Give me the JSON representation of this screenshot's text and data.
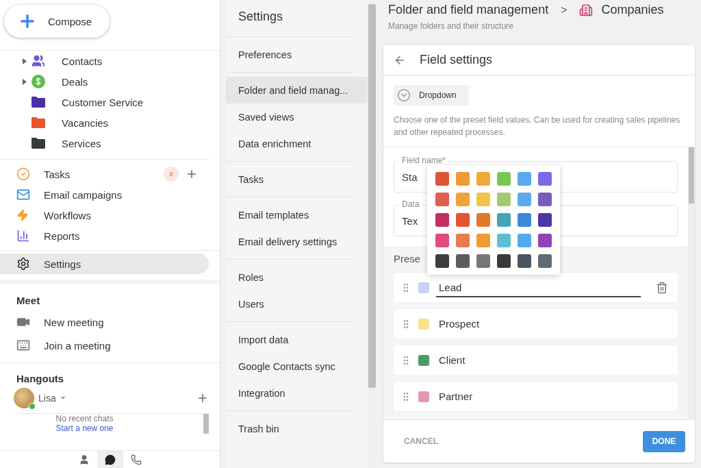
{
  "compose": {
    "label": "Compose"
  },
  "folders": [
    {
      "label": "Contacts",
      "kind": "contacts",
      "expandable": true,
      "color": "#6a5ad6"
    },
    {
      "label": "Deals",
      "kind": "deals",
      "expandable": true,
      "color": "#5cbf4a"
    },
    {
      "label": "Customer Service",
      "kind": "folder",
      "expandable": false,
      "color": "#4b2ea8"
    },
    {
      "label": "Vacancies",
      "kind": "folder",
      "expandable": false,
      "color": "#e8552d"
    },
    {
      "label": "Services",
      "kind": "folder",
      "expandable": false,
      "color": "#3a3a3a"
    }
  ],
  "apps": [
    {
      "label": "Tasks",
      "kind": "tasks",
      "badge": "8",
      "selected": false
    },
    {
      "label": "Email campaigns",
      "kind": "email",
      "selected": false
    },
    {
      "label": "Workflows",
      "kind": "workflows",
      "selected": false
    },
    {
      "label": "Reports",
      "kind": "reports",
      "selected": false
    }
  ],
  "settings_item": {
    "label": "Settings",
    "selected": true
  },
  "meet": {
    "title": "Meet",
    "items": [
      {
        "label": "New meeting",
        "kind": "video"
      },
      {
        "label": "Join a meeting",
        "kind": "keyboard"
      }
    ]
  },
  "hangouts": {
    "title": "Hangouts",
    "user": "Lisa",
    "online": true,
    "empty": "No recent chats",
    "link": "Start a new one",
    "tabs": [
      {
        "kind": "people",
        "selected": false
      },
      {
        "kind": "chat",
        "selected": true
      },
      {
        "kind": "phone",
        "selected": false
      }
    ]
  },
  "settings_panel": {
    "title": "Settings",
    "groups": [
      [
        {
          "label": "Preferences",
          "selected": false
        }
      ],
      [
        {
          "label": "Folder and field manag...",
          "selected": true
        },
        {
          "label": "Saved views",
          "selected": false
        },
        {
          "label": "Data enrichment",
          "selected": false
        }
      ],
      [
        {
          "label": "Tasks",
          "selected": false
        }
      ],
      [
        {
          "label": "Email templates",
          "selected": false
        },
        {
          "label": "Email delivery settings",
          "selected": false
        }
      ],
      [
        {
          "label": "Roles",
          "selected": false
        },
        {
          "label": "Users",
          "selected": false
        }
      ],
      [
        {
          "label": "Import data",
          "selected": false
        },
        {
          "label": "Google Contacts sync",
          "selected": false
        },
        {
          "label": "Integration",
          "selected": false
        }
      ],
      [
        {
          "label": "Trash bin",
          "selected": false
        }
      ]
    ]
  },
  "header": {
    "title": "Folder and field management",
    "separator": ">",
    "current": "Companies",
    "subtitle": "Manage folders and their structure"
  },
  "field_settings": {
    "title": "Field settings",
    "type": "Dropdown",
    "description": "Choose one of the preset field values. Can be used for creating sales pipelines and other repeated processes.",
    "fields": [
      {
        "label": "Field name*",
        "value": "Sta"
      },
      {
        "label": "Data",
        "value": "Tex"
      }
    ],
    "presets_label": "Prese",
    "palette": [
      {
        "color": "#e0533a"
      },
      {
        "color": "#ef9a36"
      },
      {
        "color": "#eeaa3a"
      },
      {
        "color": "#7ac655"
      },
      {
        "color": "#5aa9ef"
      },
      {
        "color": "#7b68e6"
      },
      {
        "color": "#dd5f4c"
      },
      {
        "color": "#efa43a"
      },
      {
        "color": "#f1c54b"
      },
      {
        "color": "#a3cb72"
      },
      {
        "color": "#5ea8ec"
      },
      {
        "color": "#7a5cbf"
      },
      {
        "color": "#c2305d"
      },
      {
        "color": "#e3562f"
      },
      {
        "color": "#df7a2b"
      },
      {
        "color": "#44a4b8"
      },
      {
        "color": "#3b88dc"
      },
      {
        "color": "#4e34a6"
      },
      {
        "color": "#de4d7c"
      },
      {
        "color": "#ec7a4e"
      },
      {
        "color": "#ef9c36"
      },
      {
        "color": "#5bbfd2"
      },
      {
        "color": "#56a7ee"
      },
      {
        "color": "#9043b5"
      },
      {
        "color": "#3b3d3f"
      },
      {
        "color": "#5c5c5c"
      },
      {
        "color": "#777777"
      },
      {
        "color": "#3a3b3d"
      },
      {
        "color": "#4a5560"
      },
      {
        "color": "#5f6c75"
      }
    ],
    "values": [
      {
        "label": "Lead",
        "color": "#c5d3f0",
        "selected": true
      },
      {
        "label": "Prospect",
        "color": "#f7e38e",
        "selected": false
      },
      {
        "label": "Client",
        "color": "#4a9d6b",
        "selected": false
      },
      {
        "label": "Partner",
        "color": "#e597ae",
        "selected": false
      }
    ],
    "cancel": "CANCEL",
    "done": "DONE"
  }
}
